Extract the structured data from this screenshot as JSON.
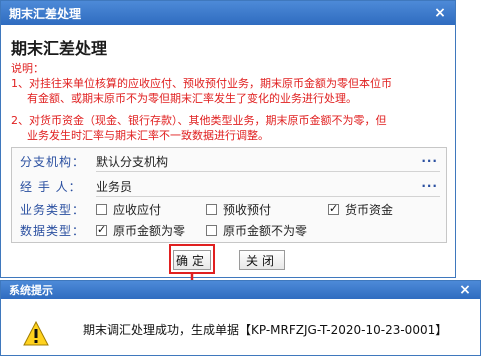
{
  "dialog": {
    "title": "期末汇差处理",
    "close": "×",
    "heading": "期末汇差处理",
    "notes": {
      "label": "说明：",
      "line1a": "1、对挂往来单位核算的应收应付、预收预付业务，期末原币金额为零但本位币",
      "line1b": "有金额、或期末原币不为零但期末汇率发生了变化的业务进行处理。",
      "line2a": "2、对货币资金（现金、银行存款）、其他类型业务，期末原币金额不为零，但",
      "line2b": "业务发生时汇率与期末汇率不一致数据进行调整。"
    },
    "form": {
      "branch": {
        "label": "分支机构：",
        "value": "默认分支机构",
        "dots": "···"
      },
      "handler": {
        "label": "经 手 人：",
        "value": "业务员",
        "dots": "···"
      },
      "biz_type": {
        "label": "业务类型：",
        "options": [
          {
            "text": "应收应付",
            "checked": false
          },
          {
            "text": "预收预付",
            "checked": false
          },
          {
            "text": "货币资金",
            "checked": true
          }
        ]
      },
      "data_type": {
        "label": "数据类型：",
        "options": [
          {
            "text": "原币金额为零",
            "checked": true
          },
          {
            "text": "原币金额不为零",
            "checked": false
          }
        ]
      }
    },
    "buttons": {
      "ok": "确定",
      "close": "关闭"
    }
  },
  "message": {
    "title": "系统提示",
    "close": "×",
    "text": "期末调汇处理成功，生成单据【KP-MRFZJG-T-2020-10-23-0001】"
  },
  "colors": {
    "title_bar": "#3a78cc",
    "note_red": "#e02020",
    "highlight": "#e02020",
    "label_blue": "#2a4fa0"
  }
}
